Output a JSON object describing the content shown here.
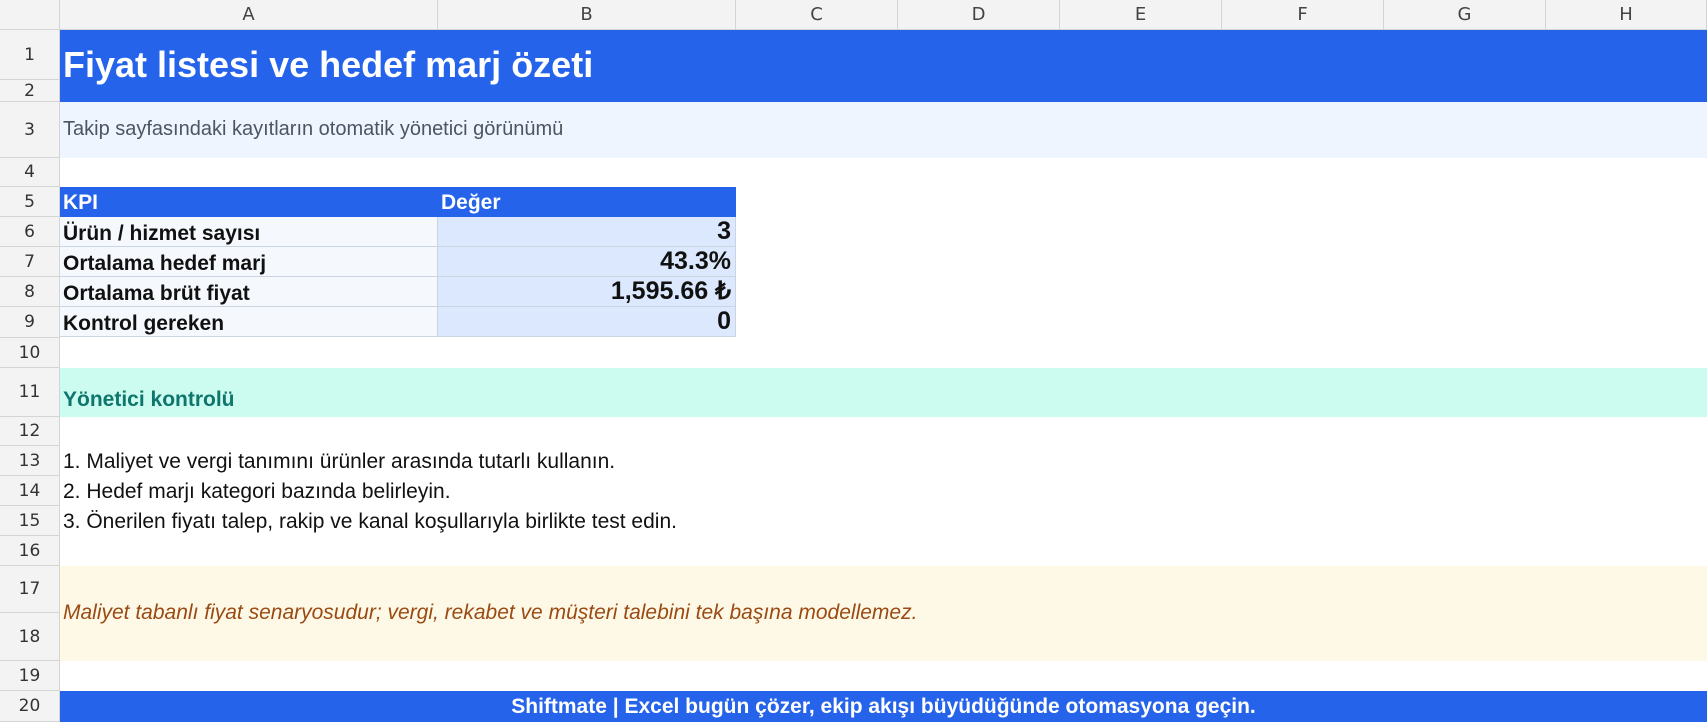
{
  "columns": [
    "A",
    "B",
    "C",
    "D",
    "E",
    "F",
    "G",
    "H"
  ],
  "rows": [
    "1",
    "2",
    "3",
    "4",
    "5",
    "6",
    "7",
    "8",
    "9",
    "10",
    "11",
    "12",
    "13",
    "14",
    "15",
    "16",
    "17",
    "18",
    "19",
    "20"
  ],
  "sheet": {
    "title": "Fiyat listesi ve hedef marj özeti",
    "subtitle": "Takip sayfasındaki kayıtların otomatik yönetici görünümü",
    "kpi_header": {
      "label": "KPI",
      "value": "Değer"
    },
    "kpis": [
      {
        "label": "Ürün / hizmet sayısı",
        "value": "3"
      },
      {
        "label": "Ortalama hedef marj",
        "value": "43.3%"
      },
      {
        "label": "Ortalama brüt fiyat",
        "value": "1,595.66 ₺"
      },
      {
        "label": "Kontrol gereken",
        "value": "0"
      }
    ],
    "section_title": "Yönetici kontrolü",
    "steps": [
      "1. Maliyet ve vergi tanımını ürünler arasında tutarlı kullanın.",
      "2. Hedef marjı kategori bazında belirleyin.",
      "3. Önerilen fiyatı talep, rakip ve kanal koşullarıyla birlikte test edin."
    ],
    "note": "Maliyet tabanlı fiyat senaryosudur; vergi, rekabet ve müşteri talebini tek başına modellemez.",
    "footer": "Shiftmate | Excel bugün çözer, ekip akışı büyüdüğünde otomasyona geçin."
  },
  "colors": {
    "header_blue": "#2563eb",
    "subtitle_bg": "#eef5ff",
    "section_bg": "#ccfbef",
    "section_text": "#0f766e",
    "note_bg": "#fef9e7",
    "note_text": "#9a4a12",
    "kpi_value_bg": "#dbe8fd"
  }
}
